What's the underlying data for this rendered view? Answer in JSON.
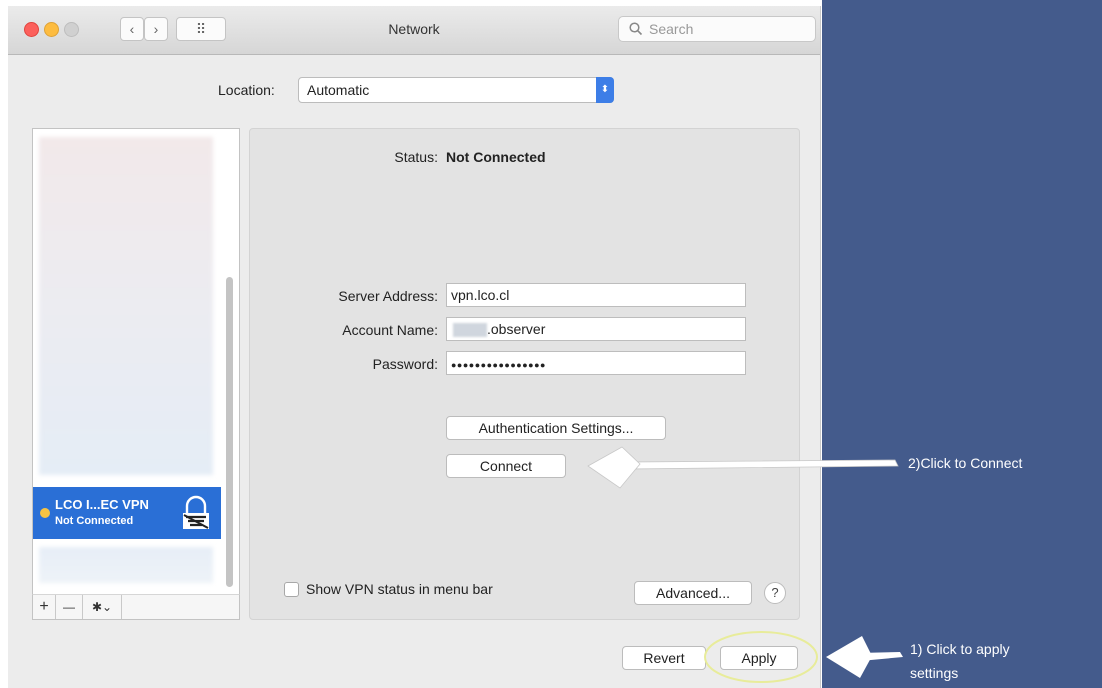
{
  "window": {
    "title": "Network",
    "search_placeholder": "Search",
    "nav_back": "‹",
    "nav_forward": "›",
    "grid_icon": "⠿"
  },
  "location": {
    "label": "Location:",
    "value": "Automatic"
  },
  "services": {
    "selected": {
      "name": "LCO I...EC VPN",
      "status": "Not Connected",
      "status_color": "#f6c343"
    },
    "add_label": "+",
    "remove_label": "—",
    "gear_label": "✱⌄"
  },
  "detail": {
    "status_label": "Status:",
    "status_value": "Not Connected",
    "server_label": "Server Address:",
    "server_value": "vpn.lco.cl",
    "account_label": "Account Name:",
    "account_value": ".observer",
    "password_label": "Password:",
    "password_value": "●●●●●●●●●●●●●●●●",
    "auth_button": "Authentication Settings...",
    "connect_button": "Connect",
    "show_vpn_label": "Show VPN status in menu bar",
    "advanced_button": "Advanced...",
    "help_button": "?"
  },
  "footer": {
    "revert_button": "Revert",
    "apply_button": "Apply"
  },
  "annotations": {
    "connect_note": "2)Click to  Connect",
    "apply_note_line1": "1) Click to apply",
    "apply_note_line2": "settings"
  },
  "colors": {
    "accent": "#2a6fd6",
    "annotation_bg": "#445b8c",
    "highlight_ring": "#e8ec9a"
  }
}
